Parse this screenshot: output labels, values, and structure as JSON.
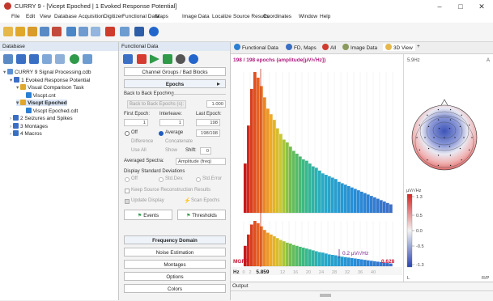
{
  "window": {
    "title": "CURRY 9 - [Vicept Epoched | 1 Evoked Response Potential]",
    "controls": [
      "–",
      "□",
      "✕"
    ]
  },
  "menu": [
    "File",
    "Edit",
    "View",
    "Database",
    "Acquisition",
    "Digitizer",
    "Functional Data",
    "Maps",
    "Image Data",
    "Localize",
    "Source Results",
    "Coordinates",
    "Window",
    "Help"
  ],
  "database": {
    "header": "Database",
    "tree": [
      {
        "label": "CURRY 9 Signal Processing.cdb",
        "indent": 0,
        "expander": "▾",
        "color": "#5b8fd6"
      },
      {
        "label": "1 Evoked Response Potential",
        "indent": 1,
        "expander": "▾",
        "color": "#3a6fc4"
      },
      {
        "label": "Visual Comparison Task",
        "indent": 2,
        "expander": "▾",
        "color": "#e0a72a"
      },
      {
        "label": "Viscpt.cnt",
        "indent": 3,
        "expander": "",
        "color": "#2c7fd1"
      },
      {
        "label": "Viscpt Epoched",
        "indent": 2,
        "expander": "▾",
        "color": "#e0a72a",
        "selected": true
      },
      {
        "label": "Viscpt Epoched.cdt",
        "indent": 3,
        "expander": "",
        "color": "#2c7fd1"
      },
      {
        "label": "2 Seizures and Spikes",
        "indent": 1,
        "expander": "›",
        "color": "#3a6fc4"
      },
      {
        "label": "3 Montages",
        "indent": 1,
        "expander": "›",
        "color": "#3a6fc4"
      },
      {
        "label": "4 Macros",
        "indent": 1,
        "expander": "›",
        "color": "#3a6fc4"
      }
    ]
  },
  "functional": {
    "header": "Functional Data",
    "channel_groups": "Channel Groups / Bad Blocks",
    "epochs": "Epochs",
    "back_to_back_section": "Back to Back Epoching",
    "back_to_back_btn": "Back to Back Epochs (s):",
    "back_to_back_value": "1.000",
    "first_epoch_label": "First Epoch:",
    "interleave_label": "Interleave:",
    "last_epoch_label": "Last Epoch:",
    "first_epoch_value": "1",
    "interleave_value": "1",
    "last_epoch_value": "198",
    "off_label": "Off",
    "average_label": "Average",
    "average_value": "198/198",
    "difference_label": "Difference",
    "concatenate_label": "Concatenate",
    "use_all_label": "Use All",
    "show_label": "Show",
    "shift_label": "Shift:",
    "shift_value": "0",
    "averaged_spectra_label": "Averaged Spectra:",
    "averaged_spectra_value": "Amplitude (freq)",
    "display_std_label": "Display Standard Deviations",
    "std_off": "Off",
    "std_dev": "Std.Dev.",
    "std_err": "Std.Error",
    "keep_source": "Keep Source Reconstruction Results",
    "update_display": "Update Display",
    "scan_epochs": "Scan Epochs",
    "events": "Events",
    "thresholds": "Thresholds",
    "frequency_domain": "Frequency Domain",
    "noise_estimation": "Noise Estimation",
    "montages": "Montages",
    "options": "Options",
    "colors": "Colors"
  },
  "tabs": [
    "Functional Data",
    "FD, Maps",
    "All",
    "Image Data",
    "3D View"
  ],
  "tab_add": "+",
  "plot": {
    "header": "198 / 198 epochs (amplitude[µV/√Hz])",
    "mgfp_label": "MGFP",
    "mgfp_value": "0.628",
    "amplitude_label": "0.2 µV/√Hz",
    "x_axis_unit": "Hz",
    "x_ticks": [
      "0",
      "2",
      "5.859",
      "12",
      "16",
      "20",
      "24",
      "28",
      "32",
      "36",
      "40"
    ],
    "cursor_value": "5.859"
  },
  "topo": {
    "freq_label": "5.9Hz",
    "corner_label": "A",
    "colorbar_title": "µV/√Hz",
    "colorbar_ticks": [
      "1.3",
      "0.5",
      "0.0",
      "-0.5",
      "-1.3"
    ],
    "left_label": "L",
    "right_label": "R/P"
  },
  "output": {
    "header": "Output"
  },
  "chart_data": [
    {
      "type": "bar",
      "title": "198 / 198 epochs (amplitude[µV/√Hz])",
      "xlabel": "Hz",
      "x": [
        0,
        1,
        2,
        3,
        4,
        5,
        6,
        7,
        8,
        9,
        10,
        11,
        12,
        13,
        14,
        15,
        16,
        17,
        18,
        19,
        20,
        21,
        22,
        23,
        24,
        25,
        26,
        27,
        28,
        29,
        30,
        31,
        32,
        33,
        34,
        35,
        36,
        37,
        38,
        39,
        40,
        41,
        42,
        43,
        44,
        45
      ],
      "values": [
        0.35,
        0.62,
        0.88,
        1.0,
        0.96,
        0.9,
        0.82,
        0.74,
        0.7,
        0.66,
        0.6,
        0.56,
        0.52,
        0.5,
        0.47,
        0.44,
        0.42,
        0.4,
        0.38,
        0.37,
        0.35,
        0.33,
        0.32,
        0.3,
        0.28,
        0.27,
        0.26,
        0.25,
        0.24,
        0.22,
        0.21,
        0.2,
        0.19,
        0.18,
        0.17,
        0.16,
        0.15,
        0.14,
        0.13,
        0.12,
        0.11,
        0.1,
        0.09,
        0.08,
        0.07,
        0.06
      ],
      "ylim": [
        0,
        1
      ]
    },
    {
      "type": "bar",
      "title": "MGFP",
      "xlabel": "Hz",
      "x": [
        0,
        1,
        2,
        3,
        4,
        5,
        6,
        7,
        8,
        9,
        10,
        11,
        12,
        13,
        14,
        15,
        16,
        17,
        18,
        19,
        20,
        21,
        22,
        23,
        24,
        25,
        26,
        27,
        28,
        29,
        30,
        31,
        32,
        33,
        34,
        35,
        36,
        37,
        38,
        39,
        40,
        41,
        42,
        43,
        44,
        45
      ],
      "values": [
        0.45,
        0.7,
        0.92,
        1.0,
        0.95,
        0.88,
        0.8,
        0.74,
        0.7,
        0.66,
        0.62,
        0.58,
        0.55,
        0.52,
        0.5,
        0.47,
        0.45,
        0.43,
        0.41,
        0.39,
        0.37,
        0.35,
        0.33,
        0.31,
        0.3,
        0.28,
        0.26,
        0.25,
        0.24,
        0.22,
        0.21,
        0.2,
        0.19,
        0.18,
        0.17,
        0.16,
        0.15,
        0.14,
        0.13,
        0.12,
        0.11,
        0.1,
        0.09,
        0.08,
        0.07,
        0.06
      ],
      "ylim": [
        0,
        1
      ]
    }
  ]
}
